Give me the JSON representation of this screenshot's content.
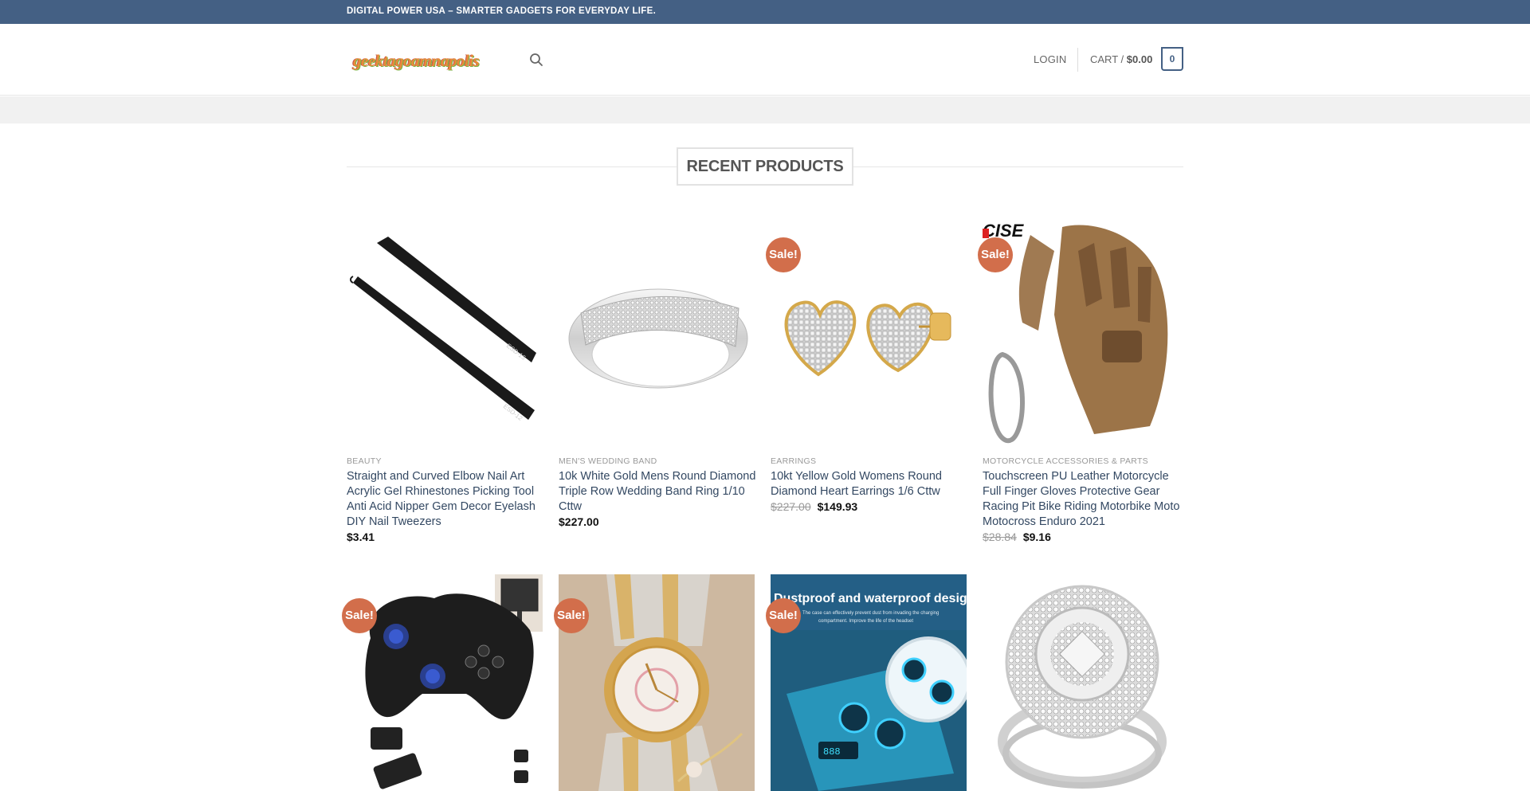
{
  "topbar": {
    "text": "DIGITAL POWER USA – SMARTER GADGETS FOR EVERYDAY LIFE."
  },
  "header": {
    "logo_text": "geektagoamnapolis",
    "login_label": "LOGIN",
    "cart_label": "CART / ",
    "cart_total": "$0.00",
    "cart_count": "0"
  },
  "section": {
    "title": "RECENT PRODUCTS"
  },
  "products": [
    {
      "category": "BEAUTY",
      "name": "Straight and Curved Elbow Nail Art Acrylic Gel Rhinestones Picking Tool Anti Acid Nipper Gem Decor Eyelash DIY Nail Tweezers",
      "old_price": "",
      "price": "$3.41",
      "sale": ""
    },
    {
      "category": "MEN'S WEDDING BAND",
      "name": "10k White Gold Mens Round Diamond Triple Row Wedding Band Ring 1/10 Cttw",
      "old_price": "",
      "price": "$227.00",
      "sale": ""
    },
    {
      "category": "EARRINGS",
      "name": "10kt Yellow Gold Womens Round Diamond Heart Earrings 1/6 Cttw",
      "old_price": "$227.00",
      "price": "$149.93",
      "sale": "Sale!"
    },
    {
      "category": "MOTORCYCLE ACCESSORIES & PARTS",
      "name": "Touchscreen PU Leather Motorcycle Full Finger Gloves Protective Gear Racing Pit Bike Riding Motorbike Moto Motocross Enduro 2021",
      "old_price": "$28.84",
      "price": "$9.16",
      "sale": "Sale!"
    },
    {
      "sale": "Sale!"
    },
    {
      "sale": "Sale!"
    },
    {
      "sale": "Sale!",
      "image_text": "Dustproof and waterproof design",
      "image_subtext": "The case can effectively prevent dust from invading the charging compartment. Improve the life of the headset"
    },
    {
      "sale": ""
    }
  ],
  "colors": {
    "topbar": "#446084",
    "sale_badge": "#d26e4b",
    "link": "#334862"
  }
}
